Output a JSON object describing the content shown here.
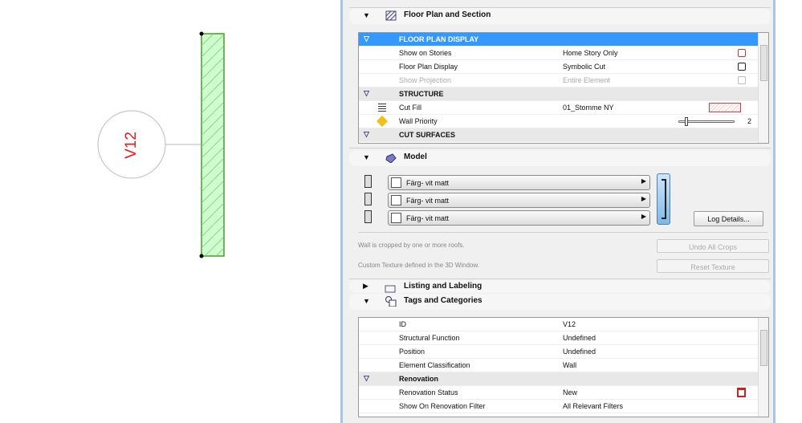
{
  "canvas": {
    "wall_id": "V12"
  },
  "floor_plan_section": {
    "title": "Floor Plan and Section",
    "rows": [
      {
        "type": "group",
        "label": "FLOOR PLAN DISPLAY",
        "selected": true
      },
      {
        "label": "Show on Stories",
        "value": "Home Story Only",
        "icon": "stories-icon"
      },
      {
        "label": "Floor Plan Display",
        "value": "Symbolic Cut",
        "icon": "display-icon"
      },
      {
        "label": "Show Projection",
        "value": "Entire Element",
        "icon": "projection-icon",
        "disabled": true
      },
      {
        "type": "group",
        "label": "STRUCTURE"
      },
      {
        "label": "Cut Fill",
        "value": "01_Stomme NY",
        "icon": "fill-swatch"
      },
      {
        "label": "Wall Priority",
        "value": "2",
        "slider_fraction": 0.1
      },
      {
        "type": "group",
        "label": "CUT SURFACES"
      }
    ]
  },
  "model": {
    "title": "Model",
    "materials": [
      "Färg- vit matt",
      "Färg- vit matt",
      "Färg- vit matt"
    ],
    "log_details": "Log Details...",
    "crop_note": "Wall is cropped by one or more roofs.",
    "undo_crops": "Undo All Crops",
    "texture_note": "Custom Texture defined in the 3D Window.",
    "reset_texture": "Reset Texture"
  },
  "listing": {
    "title": "Listing and Labeling"
  },
  "tags": {
    "title": "Tags and Categories",
    "rows": [
      {
        "label": "ID",
        "value": "V12"
      },
      {
        "label": "Structural Function",
        "value": "Undefined"
      },
      {
        "label": "Position",
        "value": "Undefined"
      },
      {
        "label": "Element Classification",
        "value": "Wall"
      },
      {
        "type": "group",
        "label": "Renovation"
      },
      {
        "label": "Renovation Status",
        "value": "New"
      },
      {
        "label": "Show On Renovation Filter",
        "value": "All Relevant Filters"
      }
    ]
  },
  "colors": {
    "selection": "#3399ff",
    "wall_fill": "#ccffcc",
    "wall_stroke": "#4a9a2a",
    "label_red": "#e02020"
  }
}
